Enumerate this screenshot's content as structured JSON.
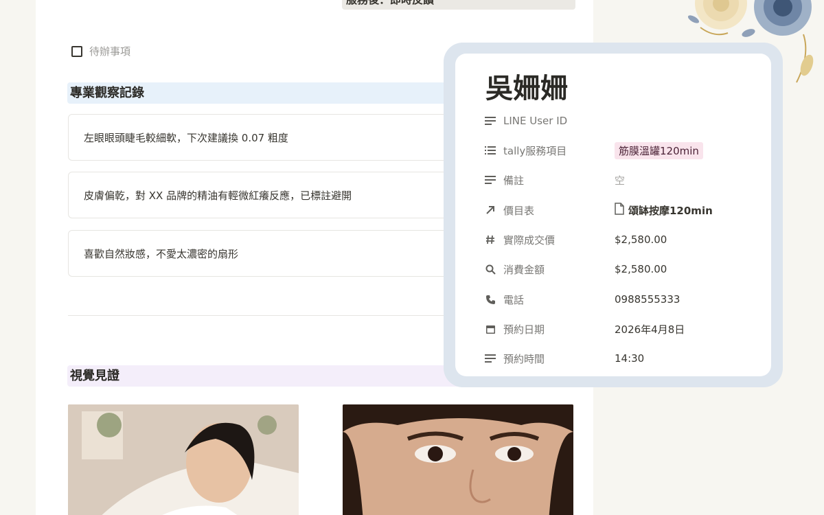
{
  "page": {
    "banner_text": "服務後：即時反饋",
    "todo_label": "待辦事項",
    "observation_heading": "專業觀察記錄",
    "notes": [
      "左眼眼頭睫毛較細軟，下次建議換 0.07 粗度",
      "皮膚偏乾，對 XX 品牌的精油有輕微紅癢反應，已標註避開",
      "喜歡自然妝感，不愛太濃密的扇形"
    ],
    "visual_heading": "視覺見證"
  },
  "record": {
    "name": "吳姍姍",
    "properties": [
      {
        "icon": "text-lines-icon",
        "label": "LINE User ID",
        "value": ""
      },
      {
        "icon": "list-icon",
        "label": "tally服務項目",
        "value": "筋膜溫罐120min",
        "type": "tag",
        "tag_color": "#f9e4ec"
      },
      {
        "icon": "text-lines-icon",
        "label": "備註",
        "value": "空",
        "type": "empty"
      },
      {
        "icon": "arrow-up-right-icon",
        "label": "價目表",
        "value": "頌缽按摩120min",
        "type": "relation"
      },
      {
        "icon": "hash-icon",
        "label": "實際成交價",
        "value": "$2,580.00"
      },
      {
        "icon": "search-icon",
        "label": "消費金額",
        "value": "$2,580.00"
      },
      {
        "icon": "phone-icon",
        "label": "電話",
        "value": "0988555333"
      },
      {
        "icon": "calendar-icon",
        "label": "預約日期",
        "value": "2026年4月8日"
      },
      {
        "icon": "text-lines-icon",
        "label": "預約時間",
        "value": "14:30"
      }
    ]
  },
  "colors": {
    "heading_blue_bg": "#e7f1fa",
    "heading_purple_bg": "#f4eefa",
    "panel_frame": "#dde5ee"
  }
}
